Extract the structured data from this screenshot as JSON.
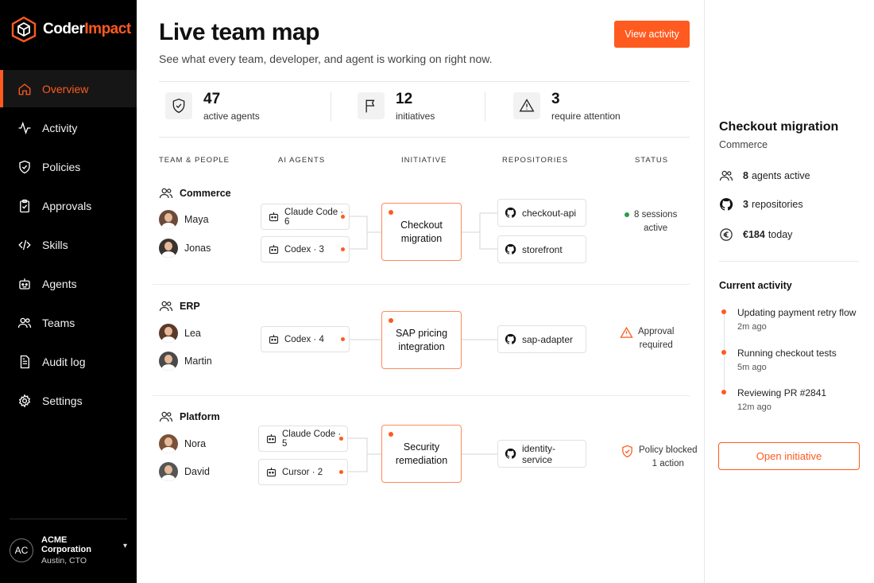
{
  "brand": {
    "name_part1": "Coder",
    "name_part2": "Impact",
    "accent": "#ff5a1f"
  },
  "sidebar": {
    "items": [
      {
        "label": "Overview",
        "icon": "home-icon",
        "active": true
      },
      {
        "label": "Activity",
        "icon": "activity-icon"
      },
      {
        "label": "Policies",
        "icon": "shield-icon"
      },
      {
        "label": "Approvals",
        "icon": "clipboard-check-icon"
      },
      {
        "label": "Skills",
        "icon": "code-icon"
      },
      {
        "label": "Agents",
        "icon": "robot-icon"
      },
      {
        "label": "Teams",
        "icon": "users-icon"
      },
      {
        "label": "Audit log",
        "icon": "document-icon"
      },
      {
        "label": "Settings",
        "icon": "gear-icon"
      }
    ],
    "org": {
      "initials": "AC",
      "name": "ACME Corporation",
      "sub": "Austin, CTO"
    }
  },
  "header": {
    "title": "Live team map",
    "subtitle": "See what every team, developer, and agent is working on right now.",
    "action_label": "View activity"
  },
  "stats": [
    {
      "value": "47",
      "label": "active agents",
      "icon": "shield-icon"
    },
    {
      "value": "12",
      "label": "initiatives",
      "icon": "flag-icon"
    },
    {
      "value": "3",
      "label": "require attention",
      "icon": "warning-icon"
    }
  ],
  "columns": [
    "TEAM & PEOPLE",
    "AI AGENTS",
    "INITIATIVE",
    "REPOSITORIES",
    "STATUS"
  ],
  "teams": [
    {
      "name": "Commerce",
      "people": [
        "Maya",
        "Jonas"
      ],
      "agents": [
        "Claude Code · 6",
        "Codex · 3"
      ],
      "initiative": "Checkout migration",
      "repos": [
        "checkout-api",
        "storefront"
      ],
      "status": {
        "type": "active",
        "line1": "8 sessions",
        "line2": "active"
      }
    },
    {
      "name": "ERP",
      "people": [
        "Lea",
        "Martin"
      ],
      "agents": [
        "Codex · 4"
      ],
      "initiative": "SAP pricing integration",
      "repos": [
        "sap-adapter"
      ],
      "status": {
        "type": "warning",
        "line1": "Approval",
        "line2": "required"
      }
    },
    {
      "name": "Platform",
      "people": [
        "Nora",
        "David"
      ],
      "agents": [
        "Claude Code · 5",
        "Cursor · 2"
      ],
      "initiative": "Security remediation",
      "repos": [
        "identity-service"
      ],
      "status": {
        "type": "blocked",
        "line1": "Policy blocked",
        "line2": "1 action"
      }
    }
  ],
  "panel": {
    "title": "Checkout migration",
    "subtitle": "Commerce",
    "stats": [
      {
        "value": "8",
        "label": "agents active",
        "icon": "users-icon"
      },
      {
        "value": "3",
        "label": "repositories",
        "icon": "github-icon"
      },
      {
        "value": "€184",
        "label": "today",
        "icon": "euro-icon"
      }
    ],
    "activity_heading": "Current activity",
    "activity": [
      {
        "text": "Updating payment retry flow",
        "time": "2m ago"
      },
      {
        "text": "Running checkout tests",
        "time": "5m ago"
      },
      {
        "text": "Reviewing PR #2841",
        "time": "12m ago"
      }
    ],
    "button_label": "Open initiative"
  }
}
